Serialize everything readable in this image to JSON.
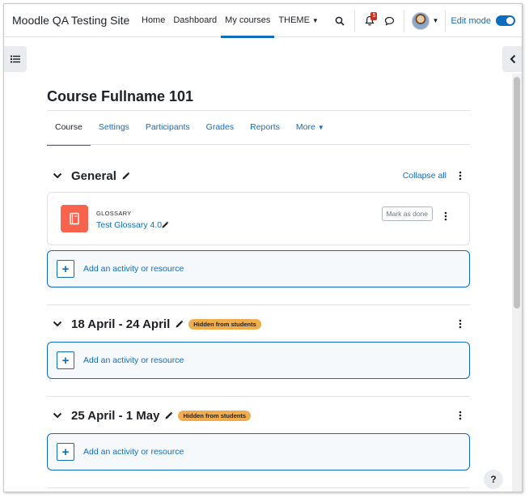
{
  "navbar": {
    "brand": "Moodle QA Testing Site",
    "items": [
      {
        "label": "Home"
      },
      {
        "label": "Dashboard"
      },
      {
        "label": "My courses"
      },
      {
        "label": "THEME"
      }
    ],
    "notification_count": "5",
    "edit_mode_label": "Edit mode",
    "edit_mode_on": true
  },
  "course": {
    "title": "Course Fullname 101",
    "tabs": [
      {
        "label": "Course"
      },
      {
        "label": "Settings"
      },
      {
        "label": "Participants"
      },
      {
        "label": "Grades"
      },
      {
        "label": "Reports"
      },
      {
        "label": "More"
      }
    ]
  },
  "sections": [
    {
      "title": "General",
      "collapse_all_label": "Collapse all",
      "activity": {
        "type": "GLOSSARY",
        "name": "Test Glossary 4.0",
        "mark_done_label": "Mark as done"
      },
      "add_label": "Add an activity or resource"
    },
    {
      "title": "18 April - 24 April",
      "badge": "Hidden from students",
      "add_label": "Add an activity or resource"
    },
    {
      "title": "25 April - 1 May",
      "badge": "Hidden from students",
      "add_label": "Add an activity or resource"
    }
  ],
  "help_label": "?",
  "colors": {
    "primary": "#0f6cbf",
    "glossary_icon": "#f7634d",
    "hidden_badge": "#f0ad4e",
    "notification_badge": "#ca3120"
  }
}
